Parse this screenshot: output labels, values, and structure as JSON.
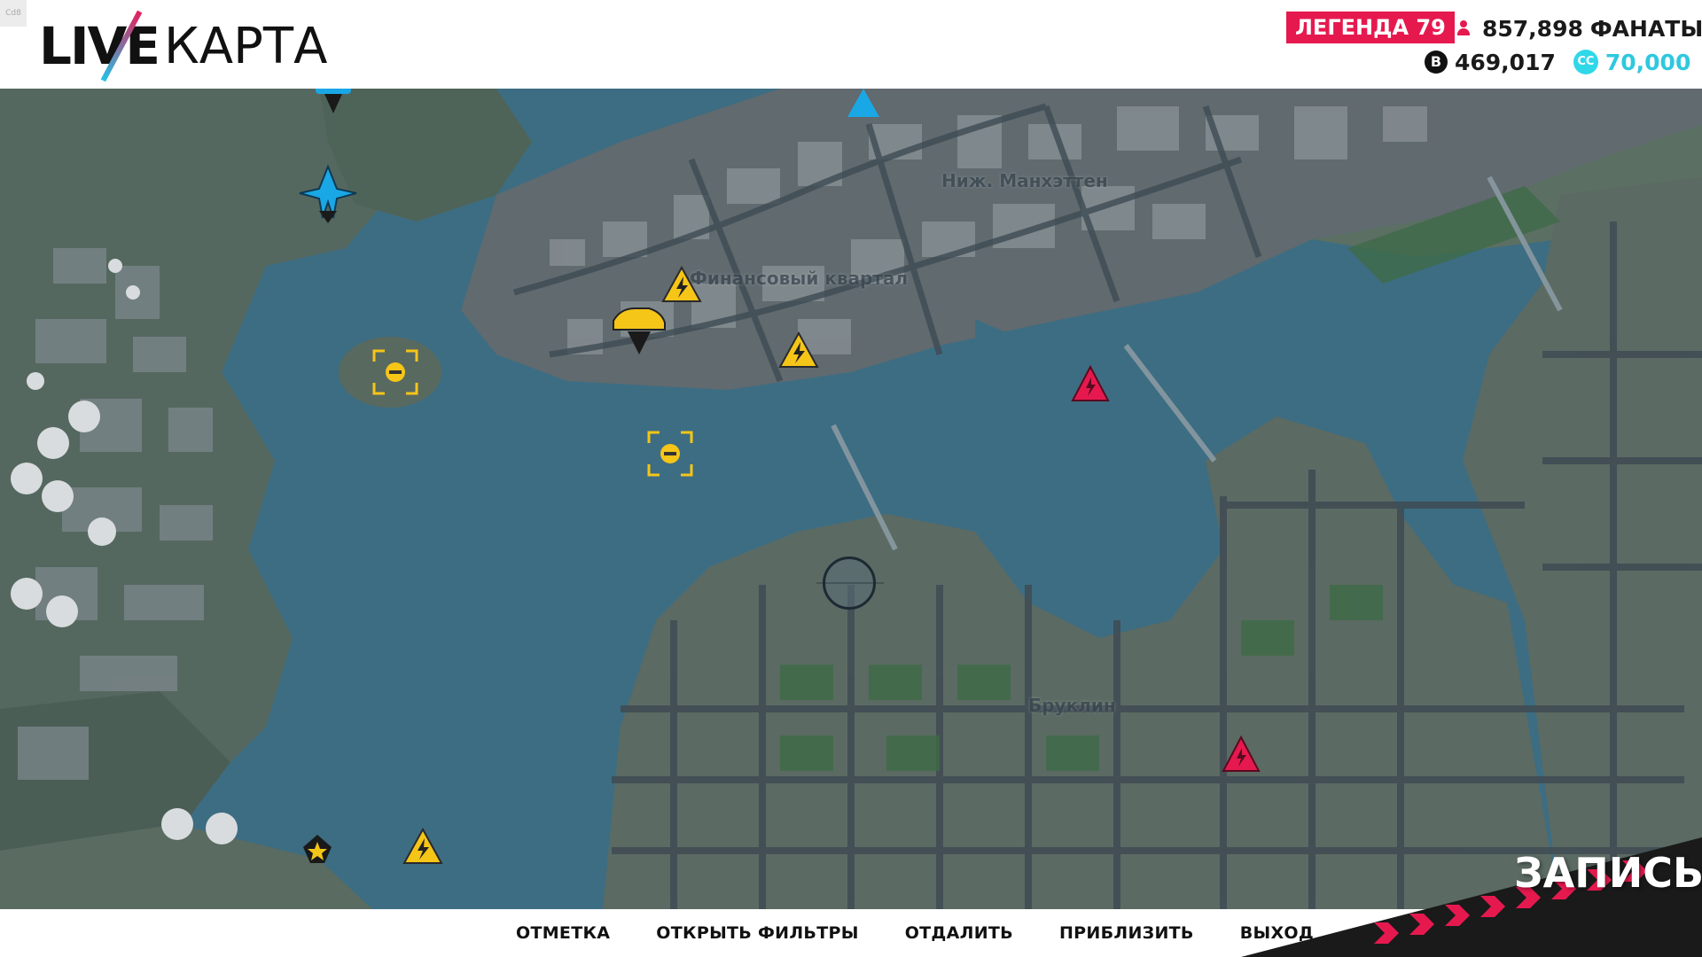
{
  "header": {
    "corner_tag": "Cd8",
    "logo_live": "LIVE",
    "logo_map": "КАРТА",
    "rank": "ЛЕГЕНДА 79",
    "fans_count": "857,898",
    "fans_label": "ФАНАТЫ",
    "bank_value": "469,017",
    "bank_icon": "bank-coin-icon",
    "cc_icon_text": "CC",
    "cc_value": "70,000"
  },
  "map": {
    "districts": {
      "lower_manhattan": "Ниж. Манхэттен",
      "financial": "Финансовый квартал",
      "brooklyn": "Бруклин"
    },
    "colors": {
      "water": "#3d6d82",
      "land": "#55685f",
      "event_yellow": "#f5c518",
      "rival_red": "#e6194f",
      "air_blue": "#1aa7e6"
    }
  },
  "footer": {
    "actions": [
      "ОТМЕТКА",
      "ОТКРЫТЬ ФИЛЬТРЫ",
      "ОТДАЛИТЬ",
      "ПРИБЛИЗИТЬ",
      "ВЫХОД"
    ],
    "record_label": "ЗАПИСЬ"
  }
}
